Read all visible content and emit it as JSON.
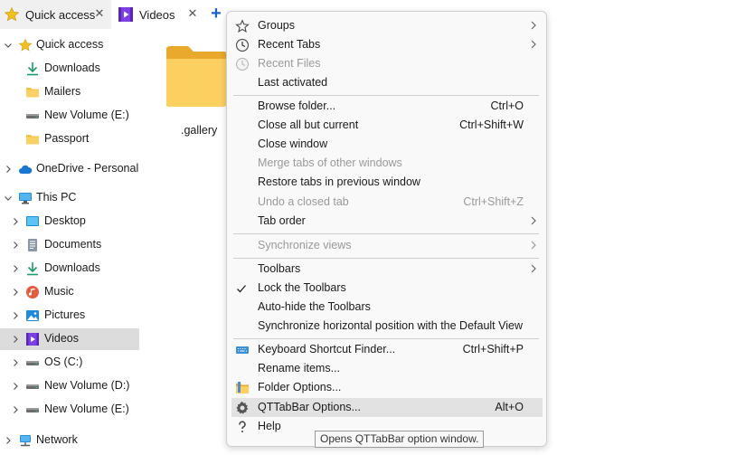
{
  "tabs": {
    "quick_access": "Quick access",
    "videos": "Videos",
    "close_glyph": "✕",
    "add_glyph": "+"
  },
  "sidebar": {
    "items": [
      {
        "label": "Quick access",
        "icon": "star-icon"
      },
      {
        "label": "Downloads",
        "icon": "download-icon"
      },
      {
        "label": "Mailers",
        "icon": "folder-icon"
      },
      {
        "label": "New Volume (E:)",
        "icon": "drive-icon"
      },
      {
        "label": "Passport",
        "icon": "folder-icon"
      },
      {
        "label": "OneDrive - Personal",
        "icon": "cloud-icon"
      },
      {
        "label": "This PC",
        "icon": "computer-icon"
      },
      {
        "label": "Desktop",
        "icon": "desktop-icon"
      },
      {
        "label": "Documents",
        "icon": "documents-icon"
      },
      {
        "label": "Downloads",
        "icon": "download-icon"
      },
      {
        "label": "Music",
        "icon": "music-icon"
      },
      {
        "label": "Pictures",
        "icon": "pictures-icon"
      },
      {
        "label": "Videos",
        "icon": "videos-icon"
      },
      {
        "label": "OS (C:)",
        "icon": "drive-icon"
      },
      {
        "label": "New Volume (D:)",
        "icon": "drive-icon"
      },
      {
        "label": "New Volume (E:)",
        "icon": "drive-icon"
      },
      {
        "label": "Network",
        "icon": "network-icon"
      }
    ]
  },
  "main": {
    "folder_label": ".gallery"
  },
  "menu": {
    "groups": "Groups",
    "recent_tabs": "Recent Tabs",
    "recent_files": "Recent Files",
    "last_activated": "Last activated",
    "browse_folder": "Browse folder...",
    "browse_folder_shortcut": "Ctrl+O",
    "close_all_but_current": "Close all but current",
    "close_all_but_current_shortcut": "Ctrl+Shift+W",
    "close_window": "Close window",
    "merge_tabs": "Merge tabs of other windows",
    "restore_tabs": "Restore tabs in previous window",
    "undo_closed_tab": "Undo a closed tab",
    "undo_closed_tab_shortcut": "Ctrl+Shift+Z",
    "tab_order": "Tab order",
    "synchronize_views": "Synchronize views",
    "toolbars": "Toolbars",
    "lock_toolbars": "Lock the Toolbars",
    "auto_hide_toolbars": "Auto-hide the Toolbars",
    "sync_horizontal": "Synchronize horizontal position with the Default View",
    "keyboard_shortcut_finder": "Keyboard Shortcut Finder...",
    "keyboard_shortcut_finder_shortcut": "Ctrl+Shift+P",
    "rename_items": "Rename items...",
    "folder_options": "Folder Options...",
    "qttabbar_options": "QTTabBar Options...",
    "qttabbar_options_shortcut": "Alt+O",
    "help": "Help"
  },
  "tooltip": {
    "text": "Opens QTTabBar option window."
  },
  "colors": {
    "accent_blue": "#1a63c8",
    "folder_yellow": "#f5c342",
    "selected_bg": "#dcdcdc",
    "menu_highlight": "#e2e2e2",
    "disabled_text": "#9a9a9a"
  }
}
